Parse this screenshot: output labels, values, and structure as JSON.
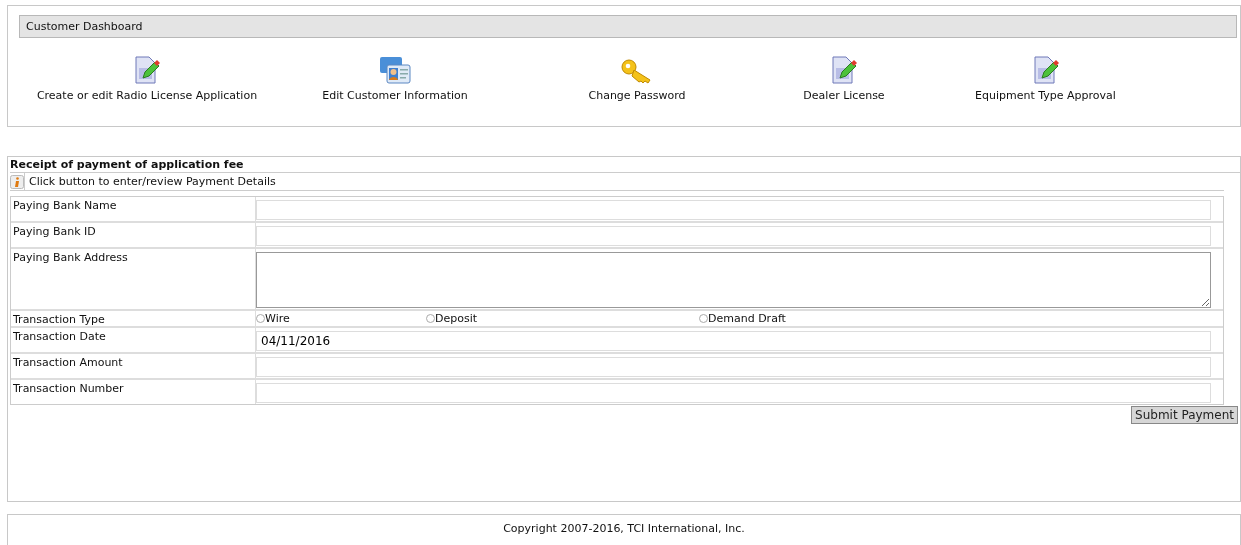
{
  "dashboard": {
    "title": "Customer Dashboard",
    "items": [
      {
        "kind": "document",
        "label": "Create or edit Radio License Application"
      },
      {
        "kind": "card",
        "label": "Edit Customer Information"
      },
      {
        "kind": "key",
        "label": "Change Password"
      },
      {
        "kind": "document",
        "label": "Dealer License"
      },
      {
        "kind": "document",
        "label": "Equipment Type Approval"
      }
    ]
  },
  "payment": {
    "title": "Receipt of payment of application fee",
    "hint": "Click button to enter/review Payment Details",
    "fields": [
      {
        "kind": "text",
        "label": "Paying Bank Name"
      },
      {
        "kind": "text",
        "label": "Paying Bank ID"
      },
      {
        "kind": "textarea",
        "label": "Paying Bank Address"
      },
      {
        "kind": "radio",
        "label": "Transaction Type",
        "options": [
          {
            "label": "Wire",
            "selected": false
          },
          {
            "label": "Deposit",
            "selected": false
          },
          {
            "label": "Demand Draft",
            "selected": false
          }
        ]
      },
      {
        "kind": "text",
        "label": "Transaction Date",
        "value": "04/11/2016"
      },
      {
        "kind": "text",
        "label": "Transaction Amount"
      },
      {
        "kind": "text",
        "label": "Transaction Number"
      }
    ],
    "submit": "Submit Payment"
  },
  "footer": "Copyright 2007-2016, TCI International, Inc."
}
